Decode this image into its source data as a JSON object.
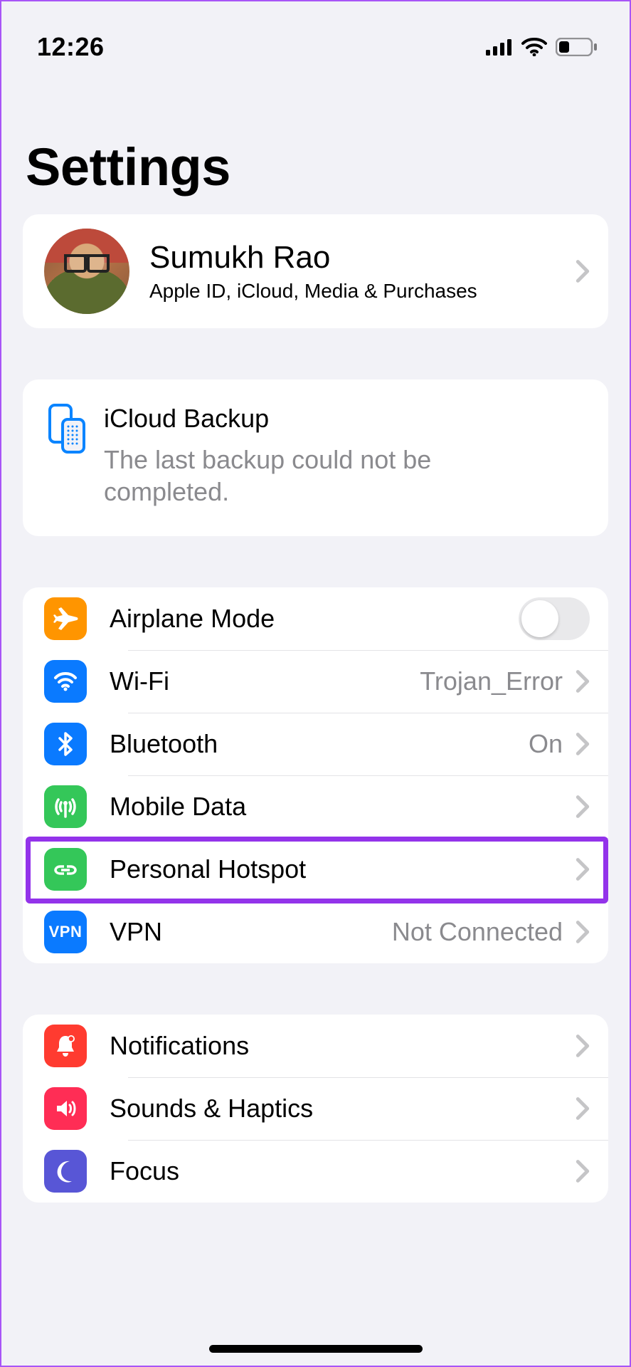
{
  "status": {
    "time": "12:26"
  },
  "title": "Settings",
  "profile": {
    "name": "Sumukh Rao",
    "subtitle": "Apple ID, iCloud, Media & Purchases"
  },
  "backup": {
    "title": "iCloud Backup",
    "subtitle": "The last backup could not be completed."
  },
  "rows": {
    "airplane": {
      "label": "Airplane Mode",
      "color": "#ff9500"
    },
    "wifi": {
      "label": "Wi-Fi",
      "value": "Trojan_Error",
      "color": "#0a7aff"
    },
    "bluetooth": {
      "label": "Bluetooth",
      "value": "On",
      "color": "#0a7aff"
    },
    "mobile": {
      "label": "Mobile Data",
      "color": "#34c759"
    },
    "hotspot": {
      "label": "Personal Hotspot",
      "color": "#34c759"
    },
    "vpn": {
      "label": "VPN",
      "value": "Not Connected",
      "color": "#0a7aff",
      "badge": "VPN"
    },
    "notifications": {
      "label": "Notifications",
      "color": "#ff3b30"
    },
    "sounds": {
      "label": "Sounds & Haptics",
      "color": "#ff2d55"
    },
    "focus": {
      "label": "Focus",
      "color": "#5856d6"
    }
  }
}
